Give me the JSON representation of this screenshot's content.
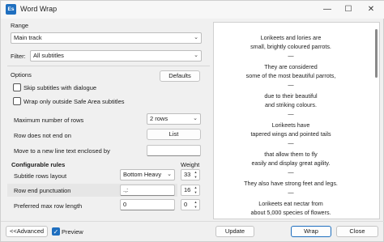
{
  "window": {
    "title": "Word Wrap",
    "app_icon": "Es",
    "minimize": "—",
    "maximize": "☐",
    "close": "✕"
  },
  "range": {
    "heading": "Range",
    "track_value": "Main track",
    "filter_label": "Filter:",
    "filter_value": "All subtitles"
  },
  "options": {
    "heading": "Options",
    "defaults_button": "Defaults",
    "skip_dialogue": {
      "label": "Skip subtitles with dialogue",
      "checked": false
    },
    "wrap_outside": {
      "label": "Wrap only outside Safe Area subtitles",
      "checked": false
    },
    "max_lines_label": "Maximum number of rows",
    "max_lines_value": "2 rows",
    "row_not_end_label": "Row does not end on",
    "row_not_end_button": "List",
    "move_enclosed_label": "Move to a new line text enclosed by",
    "move_enclosed_value": ""
  },
  "rules": {
    "heading": "Configurable rules",
    "weight_heading": "Weight",
    "rows": [
      {
        "label": "Subtitle rows layout",
        "value": "Bottom Heavy",
        "weight": "33"
      },
      {
        "label": "Row end punctuation",
        "value": ".,:",
        "weight": "16"
      },
      {
        "label": "Preferred max row length",
        "value": "0",
        "weight": "0"
      }
    ]
  },
  "preview_text": [
    "Lorikeets and lories are",
    "small, brightly coloured parrots.",
    "—",
    "They are considered",
    "some of the most beautiful parrots,",
    "—",
    "due to their beautiful",
    "and striking colours.",
    "—",
    "Lorikeets have",
    "tapered wings and pointed tails",
    "—",
    "that allow them to fly",
    "easily and display great agility.",
    "—",
    "They also have strong feet and legs.",
    "—",
    "Lorikeets eat nectar from",
    "about 5,000 species of flowers."
  ],
  "footer": {
    "advanced_button": "<<Advanced",
    "preview_label": "Preview",
    "preview_checked": true,
    "update_button": "Update",
    "wrap_button": "Wrap",
    "close_button": "Close"
  }
}
